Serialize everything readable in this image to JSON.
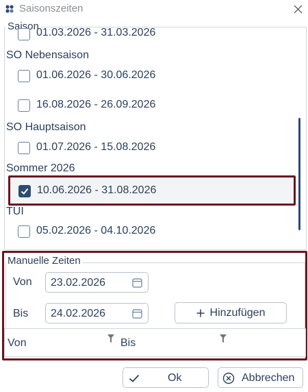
{
  "window": {
    "title": "Saisonszeiten",
    "app_icon": "app-logo-icon",
    "close_icon": "close-icon"
  },
  "saison": {
    "group_label": "Saison",
    "partial_top_item": "01.03.2026 - 31.03.2026",
    "groups": [
      {
        "name": "SO Nebensaison",
        "ranges": [
          {
            "label": "01.06.2026 - 30.06.2026",
            "checked": false
          },
          {
            "label": "16.08.2026 - 26.09.2026",
            "checked": false
          }
        ]
      },
      {
        "name": "SO Hauptsaison",
        "ranges": [
          {
            "label": "01.07.2026 - 15.08.2026",
            "checked": false
          }
        ]
      },
      {
        "name": "Sommer 2026",
        "ranges": [
          {
            "label": "10.06.2026 - 31.08.2026",
            "checked": true
          }
        ]
      },
      {
        "name": "TUI",
        "ranges": [
          {
            "label": "05.02.2026 - 04.10.2026",
            "checked": false
          }
        ]
      }
    ]
  },
  "manual": {
    "group_label": "Manuelle Zeiten",
    "von_label": "Von",
    "von_value": "23.02.2026",
    "bis_label": "Bis",
    "bis_value": "24.02.2026",
    "add_label": "Hinzufügen",
    "table": {
      "col_von": "Von",
      "col_bis": "Bis"
    }
  },
  "footer": {
    "ok_label": "Ok",
    "cancel_label": "Abbrechen"
  },
  "colors": {
    "accent": "#2e4b72",
    "highlight_frame": "#6b1420",
    "text": "#2b3f5c"
  }
}
